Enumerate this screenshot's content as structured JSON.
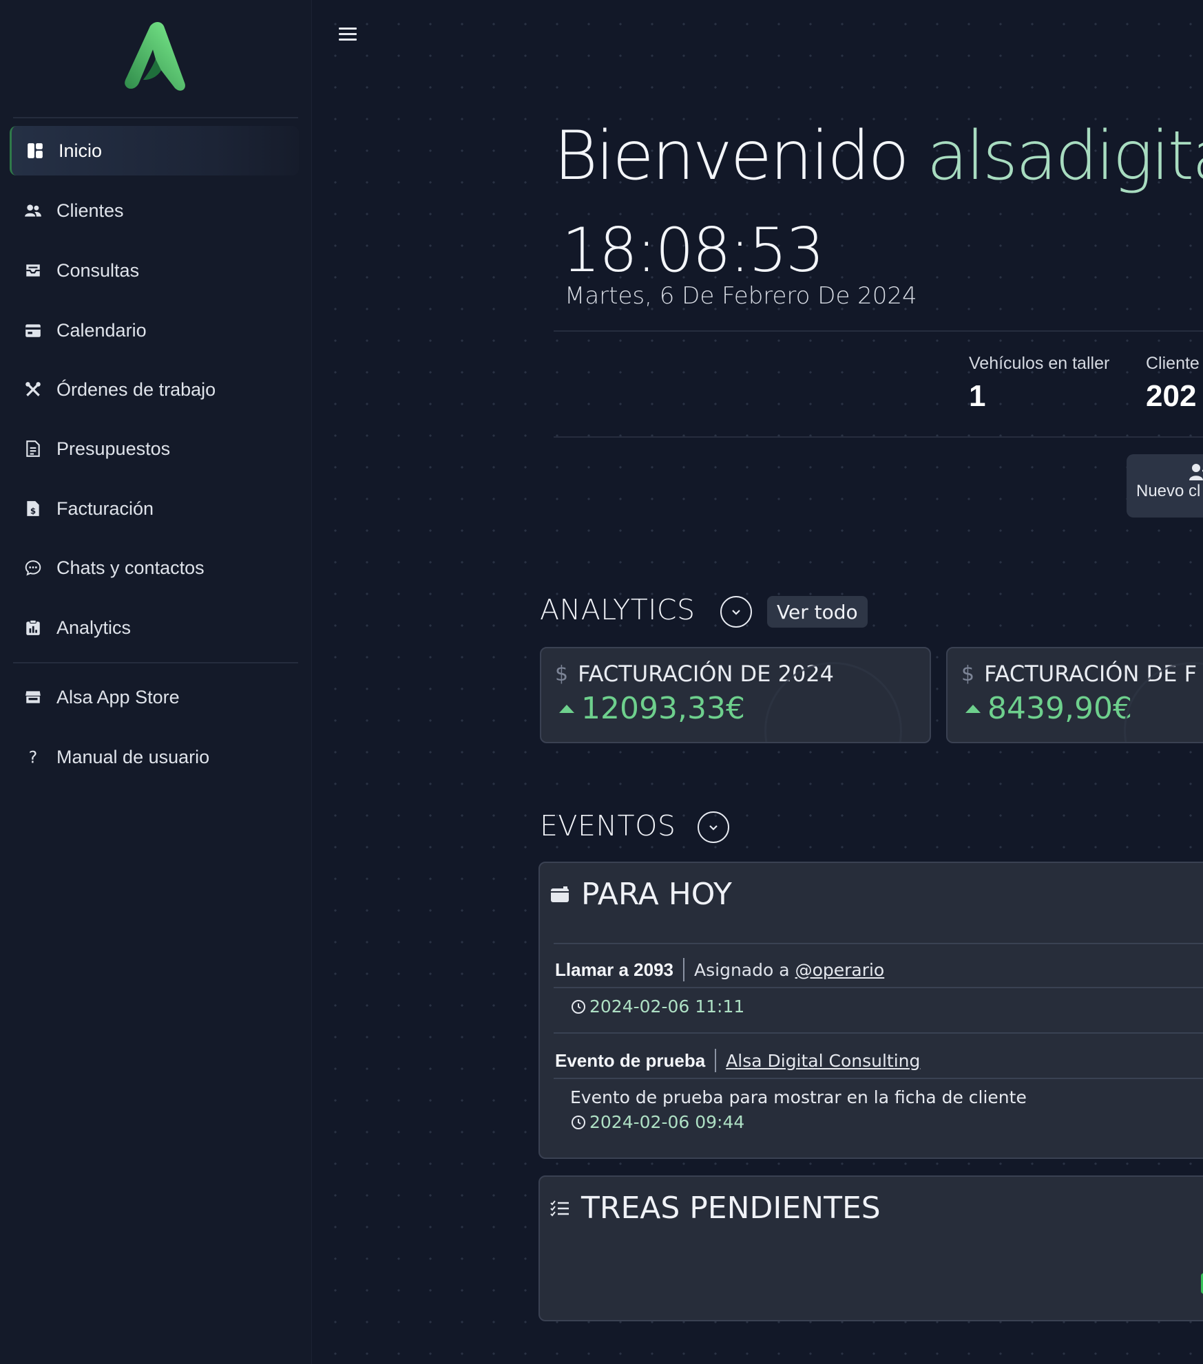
{
  "sidebar": {
    "items": [
      {
        "label": "Inicio",
        "icon": "dashboard-icon",
        "active": true
      },
      {
        "label": "Clientes",
        "icon": "users-icon"
      },
      {
        "label": "Consultas",
        "icon": "inbox-icon"
      },
      {
        "label": "Calendario",
        "icon": "calendar-icon"
      },
      {
        "label": "Órdenes de trabajo",
        "icon": "tools-icon"
      },
      {
        "label": "Presupuestos",
        "icon": "document-icon"
      },
      {
        "label": "Facturación",
        "icon": "invoice-icon"
      },
      {
        "label": "Chats y contactos",
        "icon": "chat-icon"
      },
      {
        "label": "Analytics",
        "icon": "clipboard-chart-icon"
      }
    ],
    "secondary": [
      {
        "label": "Alsa App Store",
        "icon": "store-icon"
      },
      {
        "label": "Manual de usuario",
        "icon": "question-icon"
      }
    ]
  },
  "header": {
    "welcome": "Bienvenido",
    "username": "alsadigital",
    "time": "18:08:53",
    "date": "Martes, 6 De Febrero De 2024"
  },
  "stats": [
    {
      "label": "Vehículos en taller",
      "value": "1"
    },
    {
      "label": "Cliente",
      "value": "202"
    }
  ],
  "actions": {
    "new_client": "Nuevo cl"
  },
  "analytics": {
    "title": "ANALYTICS",
    "view_all": "Ver todo",
    "cards": [
      {
        "label": "FACTURACIÓN DE 2024",
        "value": "12093,33€"
      },
      {
        "label": "FACTURACIÓN DE F",
        "value": "8439,90€"
      }
    ]
  },
  "events": {
    "title": "EVENTOS",
    "today_title": "PARA HOY",
    "items": [
      {
        "title": "Llamar a 2093",
        "assigned_prefix": "Asignado a",
        "assigned_link": "@operario",
        "datetime": "2024-02-06 11:11"
      },
      {
        "title": "Evento de prueba",
        "link": "Alsa Digital Consulting",
        "description": "Evento de prueba para mostrar en la ficha de cliente",
        "datetime": "2024-02-06 09:44"
      }
    ]
  },
  "tasks": {
    "title": "TREAS PENDIENTES"
  },
  "colors": {
    "background": "#121828",
    "sidebar": "#141a29",
    "accent_green": "#6ed08d",
    "username_green": "#a8dcc0",
    "card": "#272d3a"
  }
}
